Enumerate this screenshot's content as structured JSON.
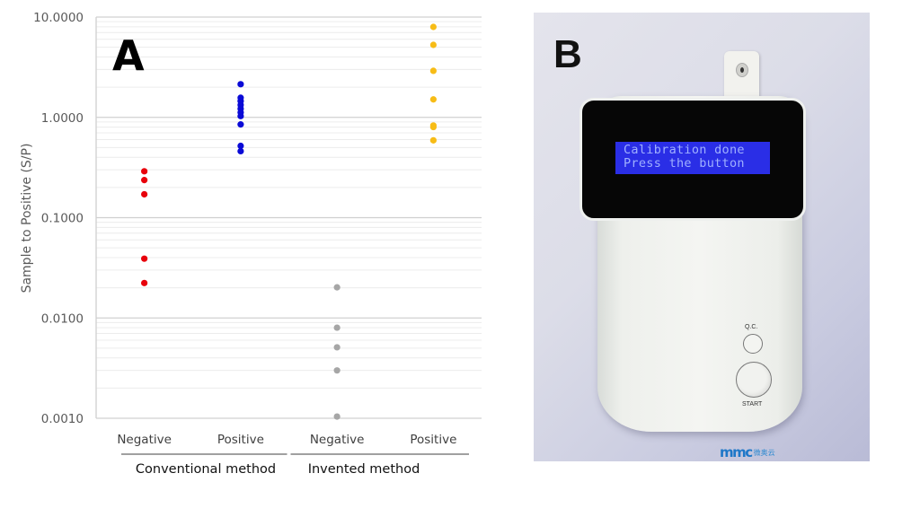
{
  "figure": {
    "panel_a_label": "A",
    "panel_b_label": "B"
  },
  "chart_data": {
    "type": "scatter",
    "title": "",
    "xlabel": "",
    "ylabel": "Sample to Positive (S/P)",
    "yscale": "log",
    "ylim": [
      0.001,
      10
    ],
    "y_ticks": [
      "10.0000",
      "1.0000",
      "0.1000",
      "0.0100",
      "0.0010"
    ],
    "y_tick_values": [
      10,
      1,
      0.1,
      0.01,
      0.001
    ],
    "grid": true,
    "legend": "none",
    "categories": [
      "Negative",
      "Positive",
      "Negative",
      "Positive"
    ],
    "groups": [
      {
        "label": "Conventional method",
        "categories": [
          0,
          1
        ]
      },
      {
        "label": "Invented method",
        "categories": [
          2,
          3
        ]
      }
    ],
    "series": [
      {
        "name": "Conventional method - Negative",
        "category": 0,
        "color": "#e8000b",
        "values": [
          0.29,
          0.237,
          0.171,
          0.039,
          0.0223
        ]
      },
      {
        "name": "Conventional method - Positive",
        "category": 1,
        "color": "#0a0ad6",
        "values": [
          2.14,
          1.57,
          1.45,
          1.33,
          1.22,
          1.12,
          1.03,
          0.85,
          0.52,
          0.46
        ]
      },
      {
        "name": "Invented method - Negative",
        "category": 2,
        "color": "#a6a6a6",
        "values": [
          0.0202,
          0.008,
          0.0051,
          0.003,
          0.00104
        ]
      },
      {
        "name": "Invented method - Positive",
        "category": 3,
        "color": "#f7bc16",
        "values": [
          7.97,
          5.28,
          2.91,
          1.51,
          0.83,
          0.8,
          0.59
        ]
      }
    ]
  },
  "device": {
    "lcd_line1": "Calibration done",
    "lcd_line2": "Press the button",
    "qc_label": "Q.C.",
    "start_label": "START",
    "logo_text": "mmc",
    "logo_cn": "微奥云",
    "lcd_color": "#2a2ee6",
    "brand_color": "#1f78c8"
  }
}
